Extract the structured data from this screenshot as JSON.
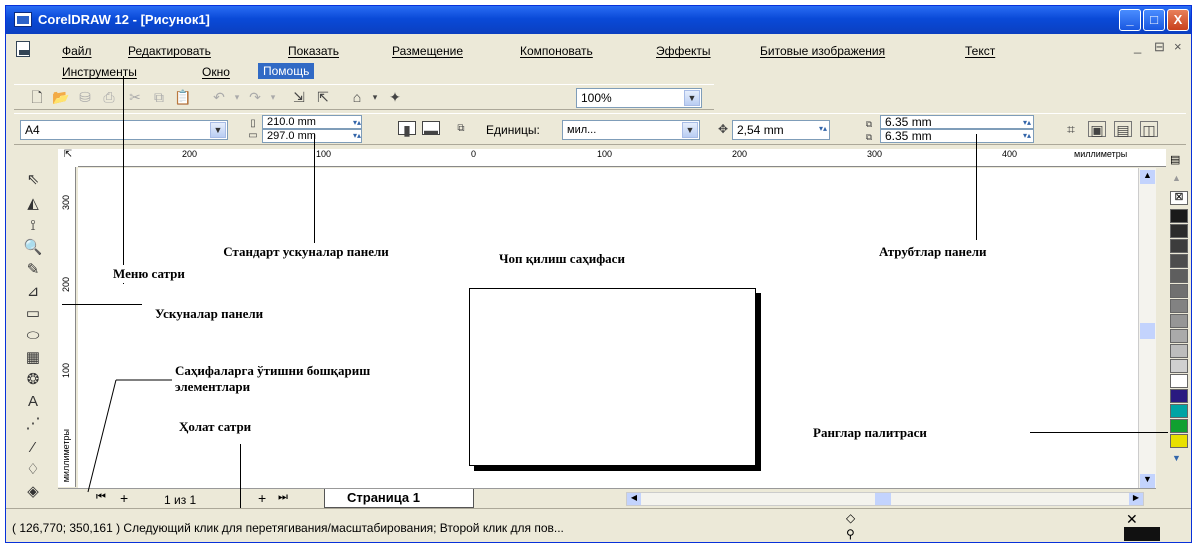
{
  "window": {
    "title": "CorelDRAW 12 - [Рисунок1]",
    "buttons": {
      "minimize": "_",
      "maximize": "□",
      "close": "X"
    }
  },
  "menu": {
    "row1": [
      "Файл",
      "Редактировать",
      "Показать",
      "Размещение",
      "Компоновать",
      "Эффекты",
      "Битовые изображения",
      "Текст"
    ],
    "row2": [
      "Инструменты",
      "Окно",
      "Помощь"
    ],
    "mdi_controls": [
      "_",
      "⊟",
      "×"
    ]
  },
  "standard_toolbar": {
    "zoom_value": "100%",
    "icons": [
      "new-icon",
      "open-icon",
      "close-icon",
      "print-icon",
      "cut-icon",
      "copy-icon",
      "paste-icon",
      "undo-icon",
      "redo-icon",
      "import-icon",
      "export-icon",
      "application-launcher-icon",
      "corel-online-icon"
    ]
  },
  "property_bar": {
    "paper_size": "A4",
    "width": "210.0 mm",
    "height": "297.0 mm",
    "units_label": "Единицы:",
    "units_value": "мил...",
    "nudge": "2,54 mm",
    "dup_x": "6.35 mm",
    "dup_y": "6.35 mm"
  },
  "ruler": {
    "h_labels": [
      "200",
      "100",
      "0",
      "100",
      "200",
      "300",
      "400"
    ],
    "unit": "миллиметры",
    "v_labels": [
      "300",
      "200",
      "100"
    ],
    "v_unit": "миллиметры"
  },
  "page_nav": {
    "counter": "1 из 1",
    "tab": "Страница 1"
  },
  "status": {
    "text": "( 126,770; 350,161 )   Следующий клик для перетягивания/масштабирования; Второй клик для пов..."
  },
  "palette": {
    "colors": [
      "#1a1a1a",
      "#2b2b2b",
      "#3c3c3c",
      "#4d4d4d",
      "#5e5e5e",
      "#707070",
      "#828282",
      "#969696",
      "#aaaaaa",
      "#bdbdbd",
      "#d0d0d0",
      "#ffffff",
      "#2a1a80",
      "#00a4a4",
      "#10a030",
      "#e8e000"
    ]
  },
  "annotations": {
    "menu_bar": "Меню сатри",
    "standard_toolbar": "Стандарт ускуналар панели",
    "print_page": "Чоп қилиш саҳифаси",
    "attributes_panel": "Атрубтлар панели",
    "toolbox": "Ускуналар панели",
    "page_nav": "Саҳифаларга ўтишни бошқариш элементлари",
    "status_bar": "Ҳолат сатри",
    "palette": "Ранглар палитраси"
  }
}
